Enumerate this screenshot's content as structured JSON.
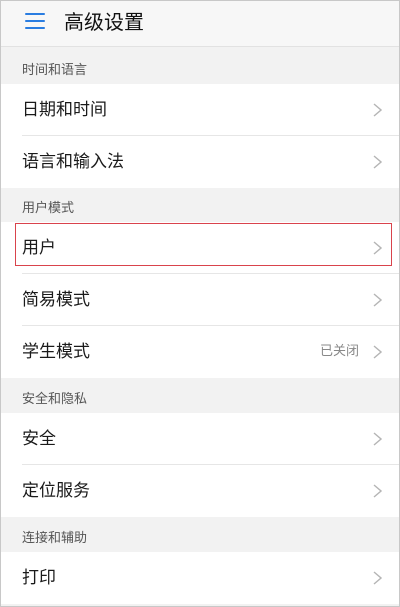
{
  "header": {
    "title": "高级设置",
    "menu_icon": "menu-icon",
    "accent_color": "#2a7de1"
  },
  "sections": [
    {
      "title": "时间和语言",
      "items": [
        {
          "label": "日期和时间",
          "value": null
        },
        {
          "label": "语言和输入法",
          "value": null
        }
      ]
    },
    {
      "title": "用户模式",
      "items": [
        {
          "label": "用户",
          "value": null,
          "highlighted": true
        },
        {
          "label": "简易模式",
          "value": null
        },
        {
          "label": "学生模式",
          "value": "已关闭"
        }
      ]
    },
    {
      "title": "安全和隐私",
      "items": [
        {
          "label": "安全",
          "value": null
        },
        {
          "label": "定位服务",
          "value": null
        }
      ]
    },
    {
      "title": "连接和辅助",
      "items": [
        {
          "label": "打印",
          "value": null
        }
      ]
    }
  ],
  "colors": {
    "highlight_border": "#d9434c",
    "chevron": "#b5b5b5"
  }
}
